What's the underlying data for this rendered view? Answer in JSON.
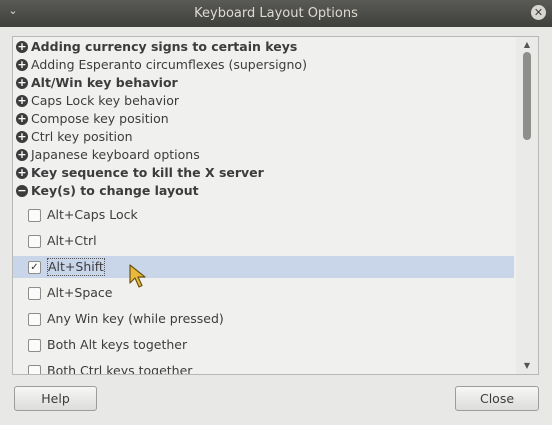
{
  "window": {
    "title": "Keyboard Layout Options",
    "menu_glyph": "⌄",
    "close_glyph": "✕"
  },
  "sections": [
    {
      "label": "Adding currency signs to certain keys",
      "expander": "+",
      "bold": true
    },
    {
      "label": "Adding Esperanto circumflexes (supersigno)",
      "expander": "+",
      "bold": false
    },
    {
      "label": "Alt/Win key behavior",
      "expander": "+",
      "bold": true
    },
    {
      "label": "Caps Lock key behavior",
      "expander": "+",
      "bold": false
    },
    {
      "label": "Compose key position",
      "expander": "+",
      "bold": false
    },
    {
      "label": "Ctrl key position",
      "expander": "+",
      "bold": false
    },
    {
      "label": "Japanese keyboard options",
      "expander": "+",
      "bold": false
    },
    {
      "label": "Key sequence to kill the X server",
      "expander": "+",
      "bold": true
    },
    {
      "label": "Key(s) to change layout",
      "expander": "−",
      "bold": true
    }
  ],
  "options": [
    {
      "label": "Alt+Caps Lock",
      "checked": false,
      "mark": ""
    },
    {
      "label": "Alt+Ctrl",
      "checked": false,
      "mark": ""
    },
    {
      "label": "Alt+Shift",
      "checked": true,
      "mark": "✓",
      "selected": true
    },
    {
      "label": "Alt+Space",
      "checked": false,
      "mark": ""
    },
    {
      "label": "Any Win key (while pressed)",
      "checked": false,
      "mark": ""
    },
    {
      "label": "Both Alt keys together",
      "checked": false,
      "mark": ""
    },
    {
      "label": "Both Ctrl keys together",
      "checked": false,
      "mark": ""
    }
  ],
  "scrollbar": {
    "up_glyph": "▲",
    "down_glyph": "▼"
  },
  "buttons": {
    "help": "Help",
    "close": "Close"
  },
  "colors": {
    "selection": "#c9d6ea",
    "titlebar": "#4a4a47",
    "cursor": "#e8b93a"
  }
}
